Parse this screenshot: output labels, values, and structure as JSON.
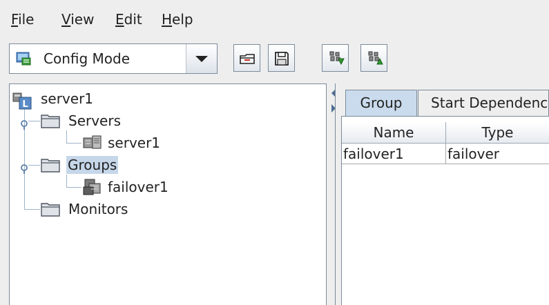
{
  "menu": {
    "items": [
      {
        "mnemonic": "F",
        "rest": "ile"
      },
      {
        "mnemonic": "V",
        "rest": "iew"
      },
      {
        "mnemonic": "E",
        "rest": "dit"
      },
      {
        "mnemonic": "H",
        "rest": "elp"
      }
    ]
  },
  "toolbar": {
    "mode_select": {
      "value": "Config Mode",
      "icon": "config-mode-icon"
    },
    "buttons": [
      {
        "icon": "open-folder-icon"
      },
      {
        "icon": "save-icon"
      },
      {
        "icon": "download-config-icon"
      },
      {
        "icon": "upload-config-icon"
      }
    ]
  },
  "tree": {
    "root": {
      "label": "server1",
      "icon": "cluster-icon"
    },
    "nodes": [
      {
        "label": "Servers",
        "icon": "folder-icon",
        "children": [
          {
            "label": "server1",
            "icon": "server-icon"
          }
        ]
      },
      {
        "label": "Groups",
        "icon": "folder-icon",
        "selected": true,
        "children": [
          {
            "label": "failover1",
            "icon": "failover-group-icon"
          }
        ]
      },
      {
        "label": "Monitors",
        "icon": "folder-icon",
        "children": []
      }
    ]
  },
  "right_panel": {
    "tabs": [
      {
        "label": "Group",
        "active": true
      },
      {
        "label": "Start Dependency",
        "active": false
      }
    ],
    "table": {
      "columns": [
        "Name",
        "Type"
      ],
      "rows": [
        [
          "failover1",
          "failover"
        ]
      ]
    }
  },
  "colors": {
    "selection": "#c6d7ea",
    "active_tab": "#c9dbec",
    "border": "#7a8a99",
    "background": "#eeeeee"
  }
}
